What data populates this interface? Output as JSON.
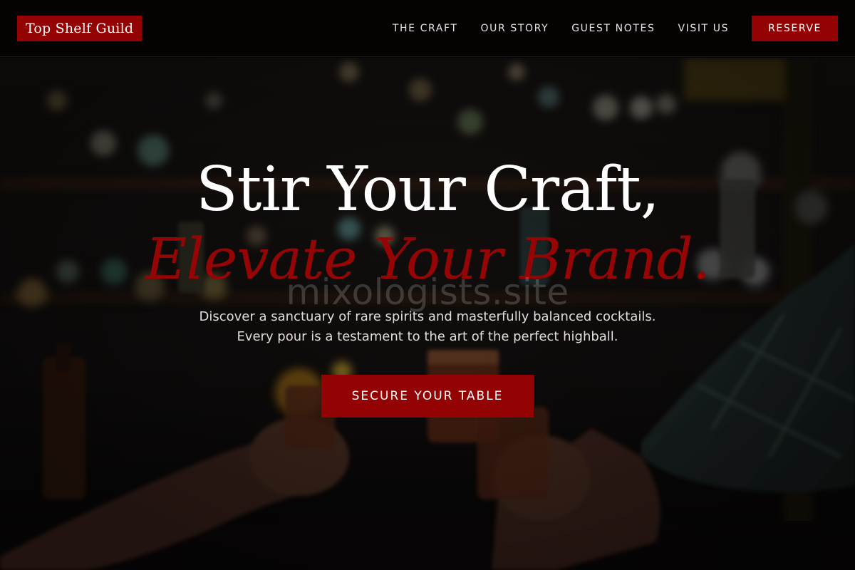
{
  "header": {
    "logo": "Top Shelf Guild",
    "nav": [
      "THE CRAFT",
      "OUR STORY",
      "GUEST NOTES",
      "VISIT US"
    ],
    "reserve_label": "RESERVE"
  },
  "hero": {
    "title_line1": "Stir Your Craft,",
    "title_line2": "Elevate Your Brand.",
    "watermark": "mixologists.site",
    "subtitle_line1": "Discover a sanctuary of rare spirits and masterfully balanced cocktails.",
    "subtitle_line2": "Every pour is a testament to the art of the perfect highball.",
    "cta_label": "SECURE YOUR TABLE",
    "background_description_icon": "bar-photo-background"
  },
  "colors": {
    "accent": "#940303",
    "header_bg": "#050202",
    "text": "#ffffff",
    "subtext": "#e2dcdc"
  }
}
